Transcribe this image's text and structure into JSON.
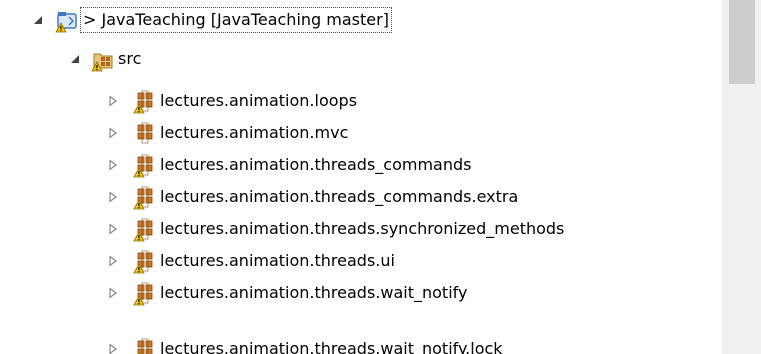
{
  "project": {
    "label": "> JavaTeaching  [JavaTeaching master]",
    "expanded": true,
    "icon": "java-project-icon"
  },
  "source_folder": {
    "label": "src",
    "expanded": true,
    "icon": "source-folder-icon"
  },
  "packages": [
    {
      "label": "lectures.animation.loops",
      "icon": "package-warning-icon"
    },
    {
      "label": "lectures.animation.mvc",
      "icon": "package-icon"
    },
    {
      "label": "lectures.animation.threads_commands",
      "icon": "package-warning-icon"
    },
    {
      "label": "lectures.animation.threads_commands.extra",
      "icon": "package-warning-icon"
    },
    {
      "label": "lectures.animation.threads.synchronized_methods",
      "icon": "package-warning-icon"
    },
    {
      "label": "lectures.animation.threads.ui",
      "icon": "package-warning-icon"
    },
    {
      "label": "lectures.animation.threads.wait_notify",
      "icon": "package-warning-icon"
    },
    {
      "label": "lectures.animation.threads.wait_notify.lock",
      "icon": "package-warning-icon"
    }
  ],
  "colors": {
    "package_brown": "#b5651d",
    "warning_yellow": "#f2c200",
    "folder_tan": "#e8c47a",
    "project_blue": "#3c78c8",
    "twisty_gray": "#8a8a8a",
    "scroll_track": "#f0f0f0",
    "scroll_thumb": "#cdcdcd"
  }
}
